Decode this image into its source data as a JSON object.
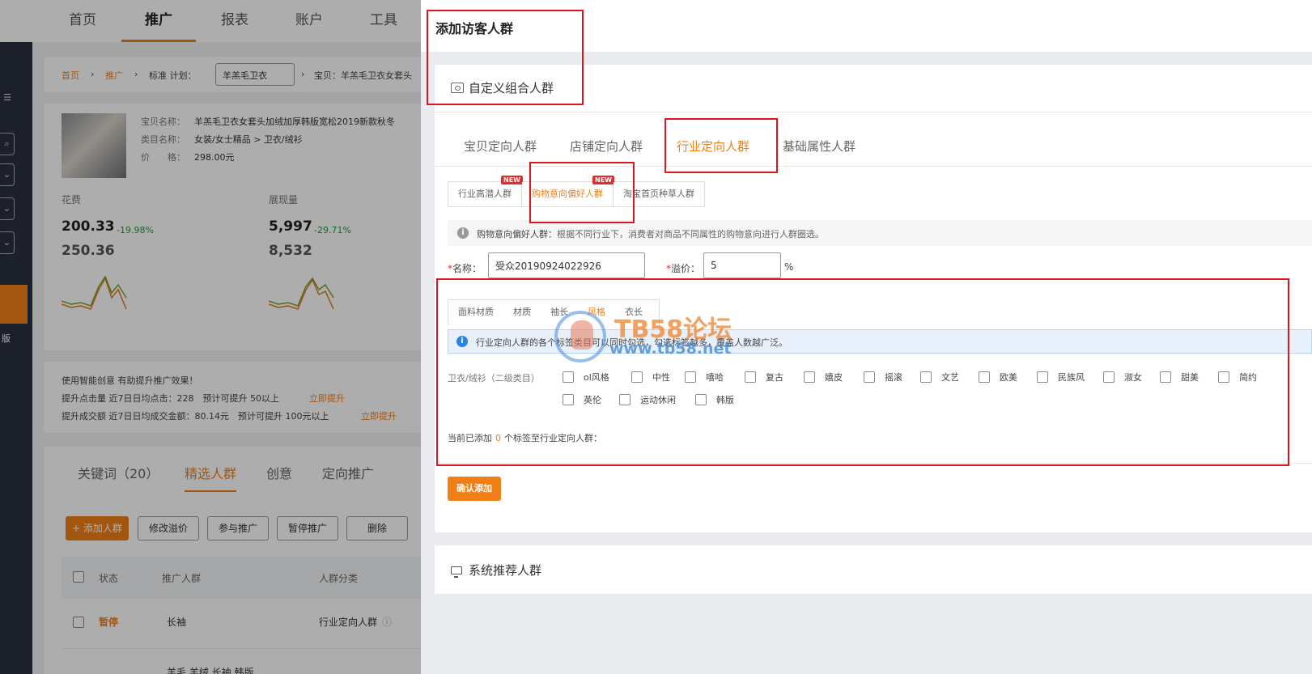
{
  "background": {
    "nav": [
      "首页",
      "推广",
      "报表",
      "账户",
      "工具"
    ],
    "nav_active": "推广",
    "breadcrumb": {
      "home": "首页",
      "promo": "推广",
      "plan_label": "标准 计划：",
      "plan_value": "羊羔毛卫衣",
      "item": "宝贝：羊羔毛卫衣女套头"
    },
    "product": {
      "name_label": "宝贝名称：",
      "name_value": "羊羔毛卫衣女套头加绒加厚韩版宽松2019新款秋冬",
      "category_label": "类目名称：",
      "category_value": "女装/女士精品 > 卫衣/绒衫",
      "price_label": "价　　格：",
      "price_value": "298.00元"
    },
    "metrics": [
      {
        "label": "花费",
        "value": "200.33",
        "change": "-19.98%",
        "prev": "250.36"
      },
      {
        "label": "展现量",
        "value": "5,997",
        "change": "-29.71%",
        "prev": "8,532"
      }
    ],
    "tip": {
      "line1": "使用智能创意 有助提升推广效果！",
      "line2": "提升点击量 近7日日均点击：228　预计可提升 50以上",
      "line3": "提升成交额 近7日日均成交金额：80.14元　预计可提升 100元以上",
      "link": "立即提升"
    },
    "list_tabs": [
      "关键词（20）",
      "精选人群",
      "创意",
      "定向推广"
    ],
    "list_tab_active": "精选人群",
    "buttons": [
      "+ 添加人群",
      "修改溢价",
      "参与推广",
      "暂停推广",
      "删除"
    ],
    "table_headers": [
      "状态",
      "推广人群",
      "人群分类"
    ],
    "rows": [
      {
        "status": "暂停",
        "name": "长袖",
        "category": "行业定向人群"
      }
    ],
    "next_row_name": "羊毛 羊绒 长袖 韩版",
    "side_text": "版"
  },
  "drawer": {
    "title": "添加访客人群",
    "custom_section": "自定义组合人群",
    "main_tabs": [
      "宝贝定向人群",
      "店铺定向人群",
      "行业定向人群",
      "基础属性人群"
    ],
    "main_tab_active": "行业定向人群",
    "sub_tabs": [
      {
        "label": "行业高潜人群",
        "badge": "NEW"
      },
      {
        "label": "购物意向偏好人群",
        "badge": "NEW"
      },
      {
        "label": "淘宝首页种草人群",
        "badge": ""
      }
    ],
    "sub_tab_active": "购物意向偏好人群",
    "info_title": "购物意向偏好人群：",
    "info_text": "根据不同行业下，消费者对商品不同属性的购物意向进行人群圈选。",
    "name_label": "名称：",
    "name_value": "受众20190924022926",
    "premium_label": "溢价：",
    "premium_value": "5",
    "premium_unit": "%",
    "tag_tabs": [
      "面料材质",
      "材质",
      "袖长",
      "风格",
      "衣长"
    ],
    "tag_tab_active": "风格",
    "blue_notice": "行业定向人群的各个标签类目可以同时勾选，勾选标签越多，覆盖人数越广泛。",
    "category_label": "卫衣/绒衫（二级类目）",
    "options": [
      "ol风格",
      "中性",
      "嘻哈",
      "复古",
      "嬉皮",
      "摇滚",
      "文艺",
      "欧美",
      "民族风",
      "淑女",
      "甜美",
      "简约",
      "英伦",
      "运动休闲",
      "韩版"
    ],
    "added_prefix": "当前已添加",
    "added_count": "0",
    "added_suffix": "个标签至行业定向人群：",
    "confirm_label": "确认添加",
    "system_section": "系统推荐人群"
  },
  "watermark": {
    "title": "TB58论坛",
    "url": "www.tb58.net"
  },
  "colors": {
    "accent": "#f07f18",
    "annotation_red": "#e0141e",
    "info_blue": "#2d82e3",
    "sidebar": "#2a3040"
  }
}
